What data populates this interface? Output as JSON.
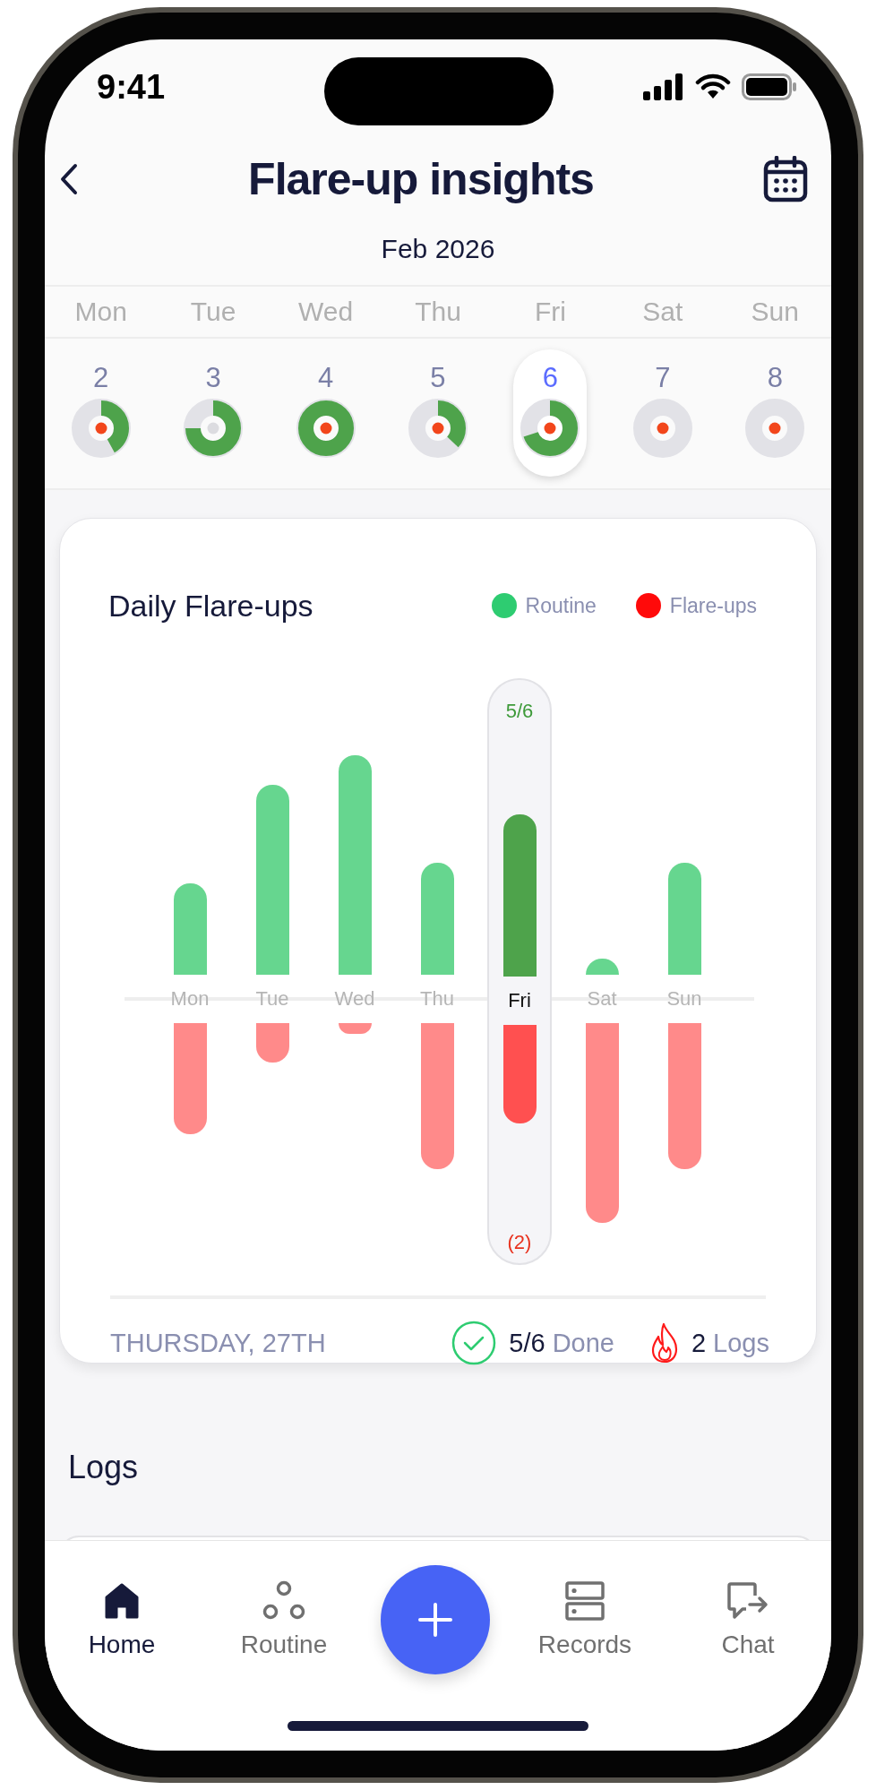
{
  "status_bar": {
    "time": "9:41"
  },
  "header": {
    "title": "Flare-up insights",
    "month": "Feb 2026"
  },
  "weekdays": [
    "Mon",
    "Tue",
    "Wed",
    "Thu",
    "Fri",
    "Sat",
    "Sun"
  ],
  "days": [
    {
      "date": "2",
      "selected": false,
      "level": 0.42,
      "flare": true
    },
    {
      "date": "3",
      "selected": false,
      "level": 0.75,
      "flare": false
    },
    {
      "date": "4",
      "selected": false,
      "level": 1,
      "flare": true
    },
    {
      "date": "5",
      "selected": false,
      "level": 0.37,
      "flare": true
    },
    {
      "date": "6",
      "selected": true,
      "level": 0.7,
      "flare": true
    },
    {
      "date": "7",
      "selected": false,
      "level": 0,
      "flare": true
    },
    {
      "date": "8",
      "selected": false,
      "level": 0,
      "flare": true
    }
  ],
  "chart": {
    "title": "Daily Flare-ups",
    "legend": [
      {
        "label": "Routine",
        "color": "#2ecc71"
      },
      {
        "label": "Flare-ups",
        "color": "#ff0a0a"
      }
    ],
    "days": [
      {
        "label": "Mon",
        "selected": false,
        "routine": {
          "level": 0.4
        },
        "flares": {
          "level": 0.54
        }
      },
      {
        "label": "Tue",
        "selected": false,
        "routine": {
          "level": 0.83
        },
        "flares": {
          "level": 0.19
        }
      },
      {
        "label": "Wed",
        "selected": false,
        "routine": {
          "level": 0.96
        },
        "flares": {
          "level": 0.05
        }
      },
      {
        "label": "Thu",
        "selected": false,
        "routine": {
          "level": 0.49
        },
        "flares": {
          "level": 0.71
        }
      },
      {
        "label": "Fri",
        "selected": true,
        "top_label": "5/6",
        "bottom_label": "(2)",
        "routine": {
          "level": 0.71
        },
        "flares": {
          "level": 0.48
        }
      },
      {
        "label": "Sat",
        "selected": false,
        "routine": {
          "level": 0.07
        },
        "flares": {
          "level": 0.97
        }
      },
      {
        "label": "Sun",
        "selected": false,
        "routine": {
          "level": 0.49
        },
        "flares": {
          "level": 0.71
        }
      }
    ],
    "footer": {
      "date": "THURSDAY, 27TH",
      "done_count": "5/6",
      "done_label": "Done",
      "logs_count": "2",
      "logs_label": "Logs"
    }
  },
  "logs": {
    "heading": "Logs"
  },
  "nav": [
    {
      "label": "Home",
      "kind": "home",
      "selected": true
    },
    {
      "label": "Routine",
      "kind": "routine",
      "selected": false
    },
    {
      "kind": "add"
    },
    {
      "label": "Records",
      "kind": "records",
      "selected": false
    },
    {
      "label": "Chat",
      "kind": "chat",
      "selected": false
    }
  ]
}
